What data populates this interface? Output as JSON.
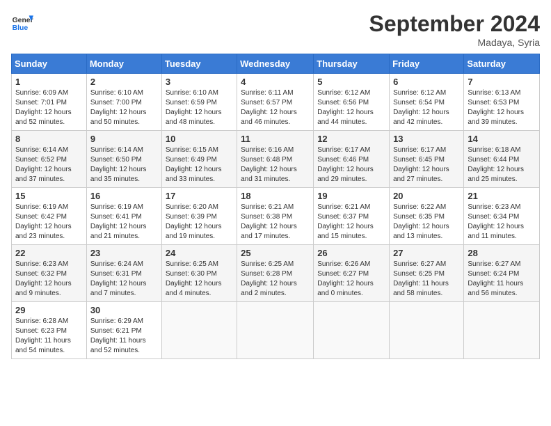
{
  "header": {
    "logo_line1": "General",
    "logo_line2": "Blue",
    "month_title": "September 2024",
    "location": "Madaya, Syria"
  },
  "weekdays": [
    "Sunday",
    "Monday",
    "Tuesday",
    "Wednesday",
    "Thursday",
    "Friday",
    "Saturday"
  ],
  "weeks": [
    [
      {
        "day": "1",
        "sunrise": "6:09 AM",
        "sunset": "7:01 PM",
        "daylight": "12 hours and 52 minutes."
      },
      {
        "day": "2",
        "sunrise": "6:10 AM",
        "sunset": "7:00 PM",
        "daylight": "12 hours and 50 minutes."
      },
      {
        "day": "3",
        "sunrise": "6:10 AM",
        "sunset": "6:59 PM",
        "daylight": "12 hours and 48 minutes."
      },
      {
        "day": "4",
        "sunrise": "6:11 AM",
        "sunset": "6:57 PM",
        "daylight": "12 hours and 46 minutes."
      },
      {
        "day": "5",
        "sunrise": "6:12 AM",
        "sunset": "6:56 PM",
        "daylight": "12 hours and 44 minutes."
      },
      {
        "day": "6",
        "sunrise": "6:12 AM",
        "sunset": "6:54 PM",
        "daylight": "12 hours and 42 minutes."
      },
      {
        "day": "7",
        "sunrise": "6:13 AM",
        "sunset": "6:53 PM",
        "daylight": "12 hours and 39 minutes."
      }
    ],
    [
      {
        "day": "8",
        "sunrise": "6:14 AM",
        "sunset": "6:52 PM",
        "daylight": "12 hours and 37 minutes."
      },
      {
        "day": "9",
        "sunrise": "6:14 AM",
        "sunset": "6:50 PM",
        "daylight": "12 hours and 35 minutes."
      },
      {
        "day": "10",
        "sunrise": "6:15 AM",
        "sunset": "6:49 PM",
        "daylight": "12 hours and 33 minutes."
      },
      {
        "day": "11",
        "sunrise": "6:16 AM",
        "sunset": "6:48 PM",
        "daylight": "12 hours and 31 minutes."
      },
      {
        "day": "12",
        "sunrise": "6:17 AM",
        "sunset": "6:46 PM",
        "daylight": "12 hours and 29 minutes."
      },
      {
        "day": "13",
        "sunrise": "6:17 AM",
        "sunset": "6:45 PM",
        "daylight": "12 hours and 27 minutes."
      },
      {
        "day": "14",
        "sunrise": "6:18 AM",
        "sunset": "6:44 PM",
        "daylight": "12 hours and 25 minutes."
      }
    ],
    [
      {
        "day": "15",
        "sunrise": "6:19 AM",
        "sunset": "6:42 PM",
        "daylight": "12 hours and 23 minutes."
      },
      {
        "day": "16",
        "sunrise": "6:19 AM",
        "sunset": "6:41 PM",
        "daylight": "12 hours and 21 minutes."
      },
      {
        "day": "17",
        "sunrise": "6:20 AM",
        "sunset": "6:39 PM",
        "daylight": "12 hours and 19 minutes."
      },
      {
        "day": "18",
        "sunrise": "6:21 AM",
        "sunset": "6:38 PM",
        "daylight": "12 hours and 17 minutes."
      },
      {
        "day": "19",
        "sunrise": "6:21 AM",
        "sunset": "6:37 PM",
        "daylight": "12 hours and 15 minutes."
      },
      {
        "day": "20",
        "sunrise": "6:22 AM",
        "sunset": "6:35 PM",
        "daylight": "12 hours and 13 minutes."
      },
      {
        "day": "21",
        "sunrise": "6:23 AM",
        "sunset": "6:34 PM",
        "daylight": "12 hours and 11 minutes."
      }
    ],
    [
      {
        "day": "22",
        "sunrise": "6:23 AM",
        "sunset": "6:32 PM",
        "daylight": "12 hours and 9 minutes."
      },
      {
        "day": "23",
        "sunrise": "6:24 AM",
        "sunset": "6:31 PM",
        "daylight": "12 hours and 7 minutes."
      },
      {
        "day": "24",
        "sunrise": "6:25 AM",
        "sunset": "6:30 PM",
        "daylight": "12 hours and 4 minutes."
      },
      {
        "day": "25",
        "sunrise": "6:25 AM",
        "sunset": "6:28 PM",
        "daylight": "12 hours and 2 minutes."
      },
      {
        "day": "26",
        "sunrise": "6:26 AM",
        "sunset": "6:27 PM",
        "daylight": "12 hours and 0 minutes."
      },
      {
        "day": "27",
        "sunrise": "6:27 AM",
        "sunset": "6:25 PM",
        "daylight": "11 hours and 58 minutes."
      },
      {
        "day": "28",
        "sunrise": "6:27 AM",
        "sunset": "6:24 PM",
        "daylight": "11 hours and 56 minutes."
      }
    ],
    [
      {
        "day": "29",
        "sunrise": "6:28 AM",
        "sunset": "6:23 PM",
        "daylight": "11 hours and 54 minutes."
      },
      {
        "day": "30",
        "sunrise": "6:29 AM",
        "sunset": "6:21 PM",
        "daylight": "11 hours and 52 minutes."
      },
      null,
      null,
      null,
      null,
      null
    ]
  ]
}
